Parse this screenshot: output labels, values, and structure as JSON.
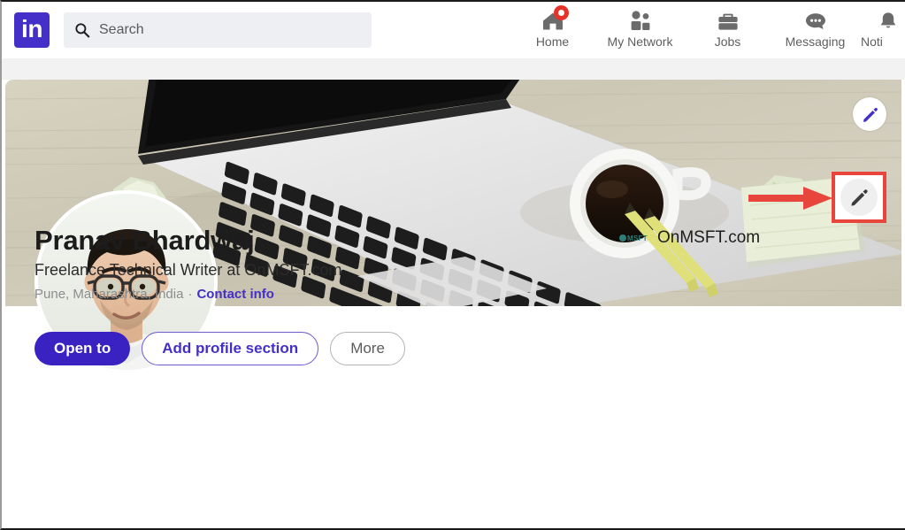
{
  "brand": {
    "logo_text": "in",
    "logo_color": "#4430c8",
    "accent_purple": "#4430c8",
    "highlight_red": "#e8453c",
    "badge_red": "#e6332a"
  },
  "search": {
    "placeholder": "Search",
    "icon": "search-icon"
  },
  "nav": {
    "items": [
      {
        "label": "Home",
        "icon": "home-icon",
        "has_badge": true
      },
      {
        "label": "My Network",
        "icon": "people-icon",
        "has_badge": false
      },
      {
        "label": "Jobs",
        "icon": "briefcase-icon",
        "has_badge": false
      },
      {
        "label": "Messaging",
        "icon": "chat-bubble-icon",
        "has_badge": false
      },
      {
        "label": "Noti",
        "icon": "bell-icon",
        "has_badge": false
      }
    ]
  },
  "cover": {
    "edit_icon": "pencil-icon",
    "description": "laptop, coffee cup, pencils and sticky notes on a light wood desk"
  },
  "avatar": {
    "alt": "profile photo of a man with glasses"
  },
  "profile": {
    "name": "Pranav Bhardwaj",
    "headline": "Freelance Technical Writer at OnMSFT.com",
    "location": "Pune, Maharashtra, India",
    "separator": "·",
    "contact_info_label": "Contact info",
    "edit_icon": "pencil-icon"
  },
  "buttons": {
    "open_to": "Open to",
    "add_profile_section": "Add profile section",
    "more": "More"
  },
  "company": {
    "logo_mark": "MSFT",
    "name": "OnMSFT.com"
  },
  "annotations": {
    "arrow_icon": "right-arrow-annotation",
    "highlight_box": "red-rectangle-highlight"
  }
}
